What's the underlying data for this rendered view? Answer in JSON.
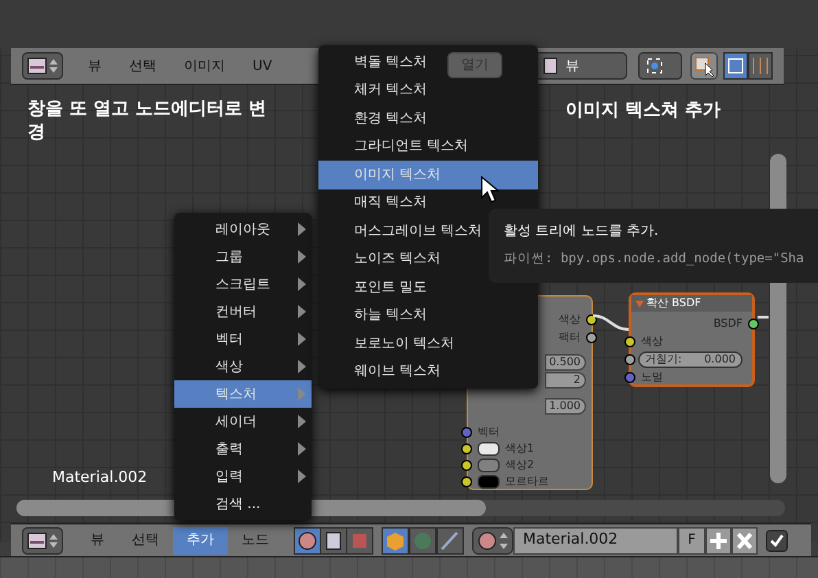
{
  "top_header": {
    "menus": [
      "뷰",
      "선택",
      "이미지",
      "UV"
    ],
    "open_button": "열기",
    "view_dropdown": "뷰"
  },
  "annotations": [
    "창을 또 열고 노드에디터로 변경",
    "이미지 텍스쳐 추가"
  ],
  "material_label": "Material.002",
  "brick_node": {
    "outputs": [
      "색상",
      "팩터"
    ],
    "fields": [
      {
        "value": "0.500"
      },
      {
        "value": "2"
      },
      {
        "value": "1.000"
      }
    ],
    "inputs": [
      {
        "label": "벡터",
        "kind": "vector"
      },
      {
        "label": "색상1",
        "kind": "color",
        "color": "#e8e8e8"
      },
      {
        "label": "색상2",
        "kind": "color",
        "color": "#808080"
      },
      {
        "label": "모르타르",
        "kind": "color",
        "color": "#000000"
      }
    ]
  },
  "diffuse_node": {
    "title": "확산 BSDF",
    "output": "BSDF",
    "color_input": "색상",
    "roughness": {
      "label": "거칠기:",
      "value": "0.000"
    },
    "normal": "노멀"
  },
  "add_menu": [
    {
      "label": "레이아웃",
      "submenu": true,
      "selected": false
    },
    {
      "label": "그룹",
      "submenu": true,
      "selected": false
    },
    {
      "label": "스크립트",
      "submenu": true,
      "selected": false
    },
    {
      "label": "컨버터",
      "submenu": true,
      "selected": false
    },
    {
      "label": "벡터",
      "submenu": true,
      "selected": false
    },
    {
      "label": "색상",
      "submenu": true,
      "selected": false
    },
    {
      "label": "텍스처",
      "submenu": true,
      "selected": true
    },
    {
      "label": "세이더",
      "submenu": true,
      "selected": false
    },
    {
      "label": "출력",
      "submenu": true,
      "selected": false
    },
    {
      "label": "입력",
      "submenu": true,
      "selected": false
    },
    {
      "label": "검색 ...",
      "submenu": false,
      "selected": false
    }
  ],
  "texture_submenu": [
    {
      "label": "벽돌 텍스처",
      "selected": false
    },
    {
      "label": "체커 텍스처",
      "selected": false
    },
    {
      "label": "환경 텍스처",
      "selected": false
    },
    {
      "label": "그라디언트 텍스처",
      "selected": false
    },
    {
      "label": "이미지 텍스처",
      "selected": true
    },
    {
      "label": "매직 텍스처",
      "selected": false
    },
    {
      "label": "머스그레이브 텍스처",
      "selected": false
    },
    {
      "label": "노이즈 텍스처",
      "selected": false
    },
    {
      "label": "포인트 밀도",
      "selected": false
    },
    {
      "label": "하늘 텍스처",
      "selected": false
    },
    {
      "label": "보로노이 텍스처",
      "selected": false
    },
    {
      "label": "웨이브 텍스처",
      "selected": false
    }
  ],
  "tooltip": {
    "description": "활성 트리에 노드를 추가.",
    "python": "파이썬: bpy.ops.node.add_node(type=\"Sha"
  },
  "bottom_header": {
    "menus": [
      {
        "label": "뷰",
        "selected": false
      },
      {
        "label": "선택",
        "selected": false
      },
      {
        "label": "추가",
        "selected": true
      },
      {
        "label": "노드",
        "selected": false
      }
    ],
    "material": "Material.002",
    "fake_user": "F",
    "use_nodes": true
  }
}
